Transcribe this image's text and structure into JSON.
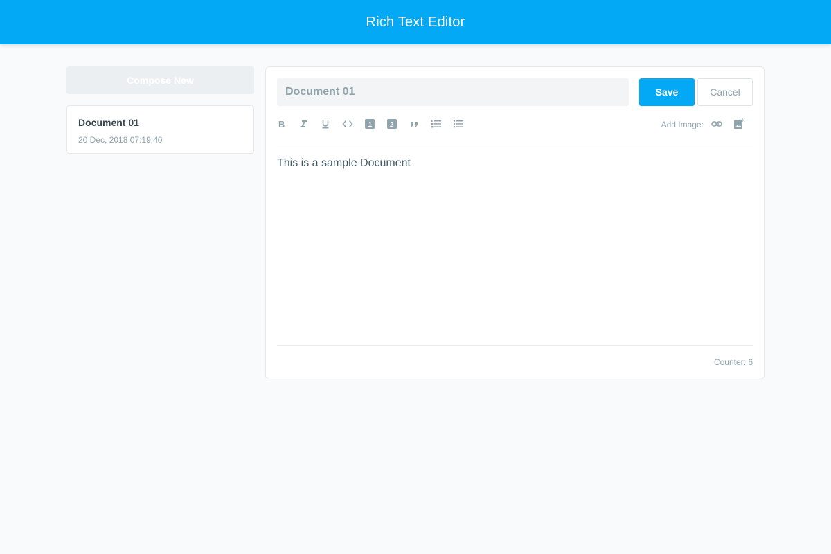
{
  "app": {
    "title": "Rich Text Editor"
  },
  "colors": {
    "accent": "#03a9f4",
    "icon": "#90a4ae"
  },
  "sidebar": {
    "compose_label": "Compose New",
    "documents": [
      {
        "title": "Document 01",
        "date": "20 Dec, 2018 07:19:40"
      }
    ]
  },
  "editor": {
    "title_value": "Document 01",
    "save_label": "Save",
    "cancel_label": "Cancel",
    "toolbar": {
      "tools": [
        "bold-icon",
        "italic-icon",
        "underline-icon",
        "code-icon",
        "heading-1-icon",
        "heading-2-icon",
        "blockquote-icon",
        "ordered-list-icon",
        "bullet-list-icon"
      ],
      "add_image_label": "Add Image:",
      "image_tools": [
        "link-icon",
        "add-photo-icon"
      ]
    },
    "content": "This is a sample Document",
    "counter_label": "Counter:",
    "counter_value": "6"
  }
}
